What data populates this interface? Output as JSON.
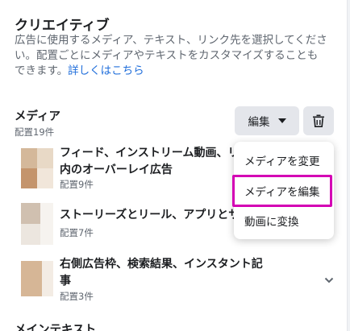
{
  "creative": {
    "title": "クリエイティブ",
    "desc_line1": "広告に使用するメディア、テキスト、リンク先を選択してくださ",
    "desc_line2": "い。配置ごとにメディアやテキストをカスタマイズすることも",
    "desc_line3": "できます。",
    "learn_more": "詳しくはこちら"
  },
  "media": {
    "label": "メディア",
    "placement_count": "配置19件",
    "edit_label": "編集",
    "rows": [
      {
        "title_line1": "フィード、インストリーム動画、リ",
        "title_line2": "内のオーバーレイ広告",
        "count": "配置9件"
      },
      {
        "title_line1": "ストーリーズとリール、アプリとサ",
        "title_line2": "",
        "count": "配置7件"
      },
      {
        "title_line1": "右側広告枠、検索結果、インスタント記",
        "title_line2": "事",
        "count": "配置3件"
      }
    ]
  },
  "dropdown": {
    "items": [
      "メディアを変更",
      "メディアを編集",
      "動画に変換"
    ]
  },
  "primary_text": {
    "label": "メインテキスト"
  },
  "colors": {
    "highlight": "#d400b4",
    "link": "#216fdb",
    "button_bg": "#e4e6eb"
  }
}
